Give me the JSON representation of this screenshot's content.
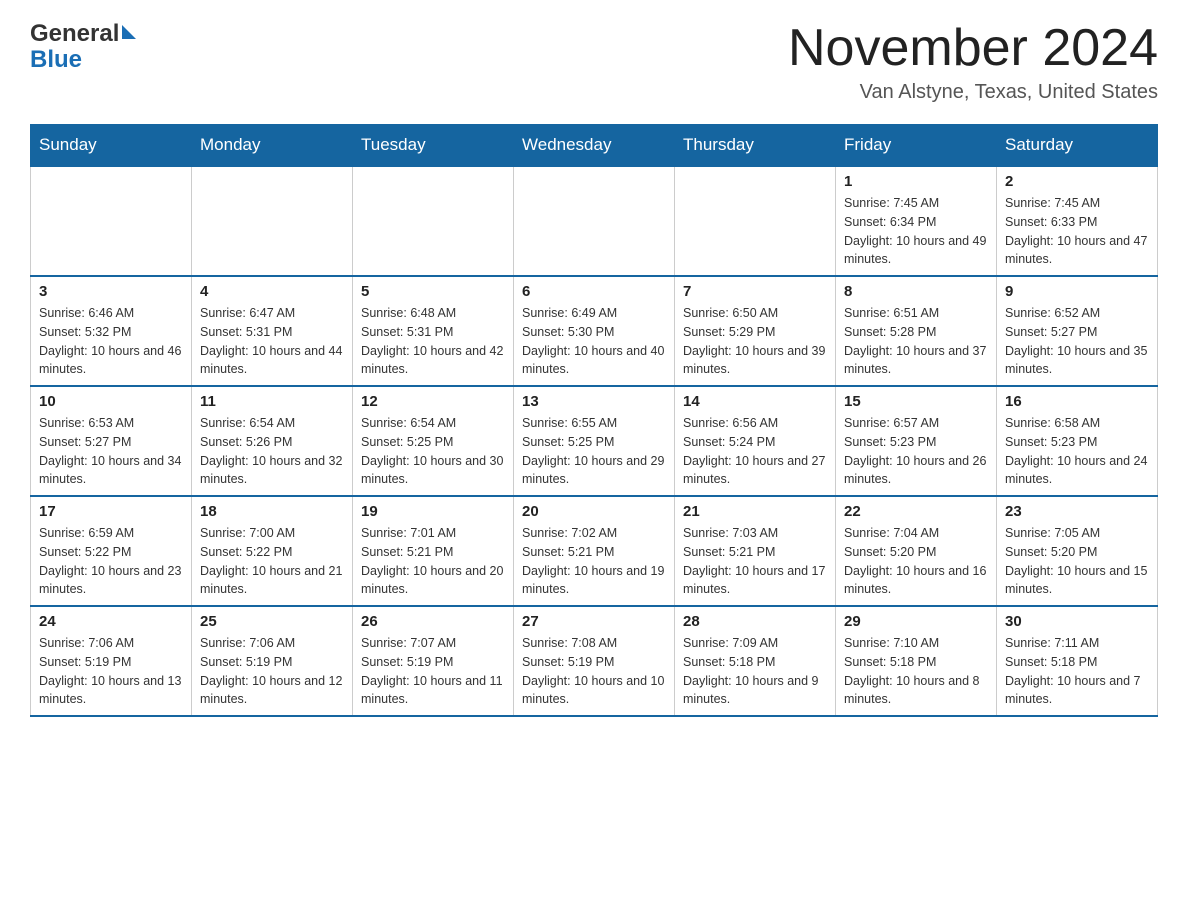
{
  "header": {
    "logo_general": "General",
    "logo_blue": "Blue",
    "month_title": "November 2024",
    "location": "Van Alstyne, Texas, United States"
  },
  "days_of_week": [
    "Sunday",
    "Monday",
    "Tuesday",
    "Wednesday",
    "Thursday",
    "Friday",
    "Saturday"
  ],
  "weeks": [
    [
      {
        "day": "",
        "sunrise": "",
        "sunset": "",
        "daylight": ""
      },
      {
        "day": "",
        "sunrise": "",
        "sunset": "",
        "daylight": ""
      },
      {
        "day": "",
        "sunrise": "",
        "sunset": "",
        "daylight": ""
      },
      {
        "day": "",
        "sunrise": "",
        "sunset": "",
        "daylight": ""
      },
      {
        "day": "",
        "sunrise": "",
        "sunset": "",
        "daylight": ""
      },
      {
        "day": "1",
        "sunrise": "Sunrise: 7:45 AM",
        "sunset": "Sunset: 6:34 PM",
        "daylight": "Daylight: 10 hours and 49 minutes."
      },
      {
        "day": "2",
        "sunrise": "Sunrise: 7:45 AM",
        "sunset": "Sunset: 6:33 PM",
        "daylight": "Daylight: 10 hours and 47 minutes."
      }
    ],
    [
      {
        "day": "3",
        "sunrise": "Sunrise: 6:46 AM",
        "sunset": "Sunset: 5:32 PM",
        "daylight": "Daylight: 10 hours and 46 minutes."
      },
      {
        "day": "4",
        "sunrise": "Sunrise: 6:47 AM",
        "sunset": "Sunset: 5:31 PM",
        "daylight": "Daylight: 10 hours and 44 minutes."
      },
      {
        "day": "5",
        "sunrise": "Sunrise: 6:48 AM",
        "sunset": "Sunset: 5:31 PM",
        "daylight": "Daylight: 10 hours and 42 minutes."
      },
      {
        "day": "6",
        "sunrise": "Sunrise: 6:49 AM",
        "sunset": "Sunset: 5:30 PM",
        "daylight": "Daylight: 10 hours and 40 minutes."
      },
      {
        "day": "7",
        "sunrise": "Sunrise: 6:50 AM",
        "sunset": "Sunset: 5:29 PM",
        "daylight": "Daylight: 10 hours and 39 minutes."
      },
      {
        "day": "8",
        "sunrise": "Sunrise: 6:51 AM",
        "sunset": "Sunset: 5:28 PM",
        "daylight": "Daylight: 10 hours and 37 minutes."
      },
      {
        "day": "9",
        "sunrise": "Sunrise: 6:52 AM",
        "sunset": "Sunset: 5:27 PM",
        "daylight": "Daylight: 10 hours and 35 minutes."
      }
    ],
    [
      {
        "day": "10",
        "sunrise": "Sunrise: 6:53 AM",
        "sunset": "Sunset: 5:27 PM",
        "daylight": "Daylight: 10 hours and 34 minutes."
      },
      {
        "day": "11",
        "sunrise": "Sunrise: 6:54 AM",
        "sunset": "Sunset: 5:26 PM",
        "daylight": "Daylight: 10 hours and 32 minutes."
      },
      {
        "day": "12",
        "sunrise": "Sunrise: 6:54 AM",
        "sunset": "Sunset: 5:25 PM",
        "daylight": "Daylight: 10 hours and 30 minutes."
      },
      {
        "day": "13",
        "sunrise": "Sunrise: 6:55 AM",
        "sunset": "Sunset: 5:25 PM",
        "daylight": "Daylight: 10 hours and 29 minutes."
      },
      {
        "day": "14",
        "sunrise": "Sunrise: 6:56 AM",
        "sunset": "Sunset: 5:24 PM",
        "daylight": "Daylight: 10 hours and 27 minutes."
      },
      {
        "day": "15",
        "sunrise": "Sunrise: 6:57 AM",
        "sunset": "Sunset: 5:23 PM",
        "daylight": "Daylight: 10 hours and 26 minutes."
      },
      {
        "day": "16",
        "sunrise": "Sunrise: 6:58 AM",
        "sunset": "Sunset: 5:23 PM",
        "daylight": "Daylight: 10 hours and 24 minutes."
      }
    ],
    [
      {
        "day": "17",
        "sunrise": "Sunrise: 6:59 AM",
        "sunset": "Sunset: 5:22 PM",
        "daylight": "Daylight: 10 hours and 23 minutes."
      },
      {
        "day": "18",
        "sunrise": "Sunrise: 7:00 AM",
        "sunset": "Sunset: 5:22 PM",
        "daylight": "Daylight: 10 hours and 21 minutes."
      },
      {
        "day": "19",
        "sunrise": "Sunrise: 7:01 AM",
        "sunset": "Sunset: 5:21 PM",
        "daylight": "Daylight: 10 hours and 20 minutes."
      },
      {
        "day": "20",
        "sunrise": "Sunrise: 7:02 AM",
        "sunset": "Sunset: 5:21 PM",
        "daylight": "Daylight: 10 hours and 19 minutes."
      },
      {
        "day": "21",
        "sunrise": "Sunrise: 7:03 AM",
        "sunset": "Sunset: 5:21 PM",
        "daylight": "Daylight: 10 hours and 17 minutes."
      },
      {
        "day": "22",
        "sunrise": "Sunrise: 7:04 AM",
        "sunset": "Sunset: 5:20 PM",
        "daylight": "Daylight: 10 hours and 16 minutes."
      },
      {
        "day": "23",
        "sunrise": "Sunrise: 7:05 AM",
        "sunset": "Sunset: 5:20 PM",
        "daylight": "Daylight: 10 hours and 15 minutes."
      }
    ],
    [
      {
        "day": "24",
        "sunrise": "Sunrise: 7:06 AM",
        "sunset": "Sunset: 5:19 PM",
        "daylight": "Daylight: 10 hours and 13 minutes."
      },
      {
        "day": "25",
        "sunrise": "Sunrise: 7:06 AM",
        "sunset": "Sunset: 5:19 PM",
        "daylight": "Daylight: 10 hours and 12 minutes."
      },
      {
        "day": "26",
        "sunrise": "Sunrise: 7:07 AM",
        "sunset": "Sunset: 5:19 PM",
        "daylight": "Daylight: 10 hours and 11 minutes."
      },
      {
        "day": "27",
        "sunrise": "Sunrise: 7:08 AM",
        "sunset": "Sunset: 5:19 PM",
        "daylight": "Daylight: 10 hours and 10 minutes."
      },
      {
        "day": "28",
        "sunrise": "Sunrise: 7:09 AM",
        "sunset": "Sunset: 5:18 PM",
        "daylight": "Daylight: 10 hours and 9 minutes."
      },
      {
        "day": "29",
        "sunrise": "Sunrise: 7:10 AM",
        "sunset": "Sunset: 5:18 PM",
        "daylight": "Daylight: 10 hours and 8 minutes."
      },
      {
        "day": "30",
        "sunrise": "Sunrise: 7:11 AM",
        "sunset": "Sunset: 5:18 PM",
        "daylight": "Daylight: 10 hours and 7 minutes."
      }
    ]
  ]
}
